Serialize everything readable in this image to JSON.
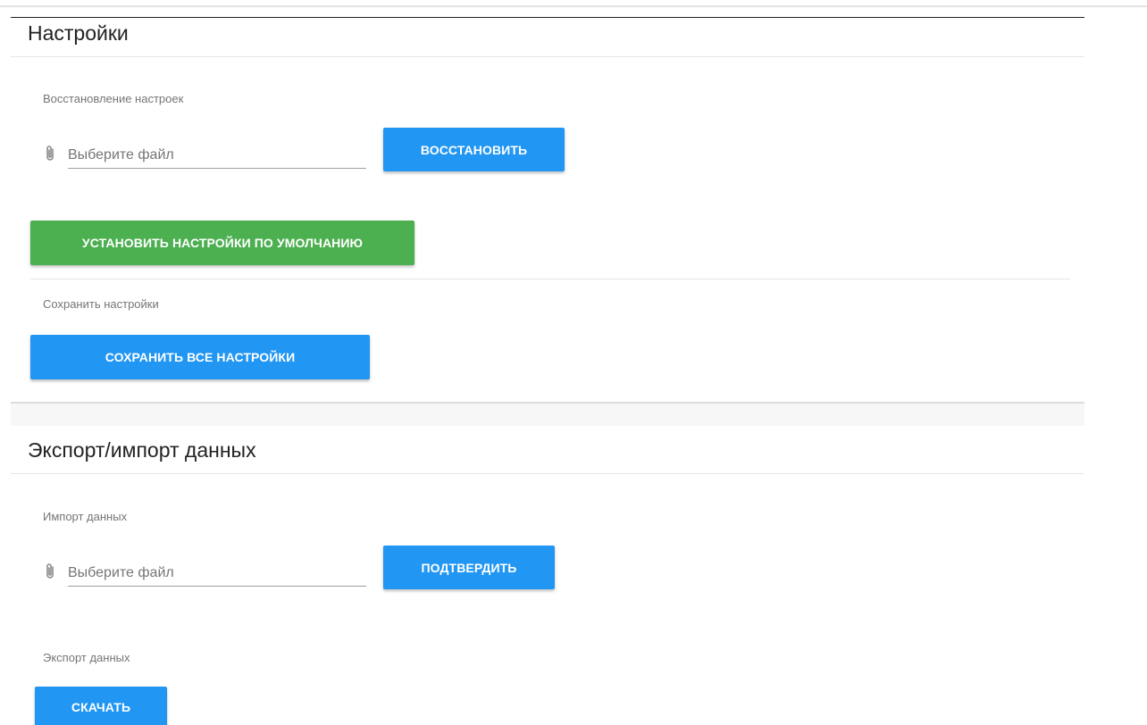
{
  "settings": {
    "title": "Настройки",
    "restore": {
      "label": "Восстановление настроек",
      "file_placeholder": "Выберите файл",
      "file_icon": "paperclip-icon",
      "button_label": "ВОССТАНОВИТЬ"
    },
    "defaults_button_label": "УСТАНОВИТЬ НАСТРОЙКИ ПО УМОЛЧАНИЮ",
    "save": {
      "label": "Сохранить настройки",
      "button_label": "СОХРАНИТЬ ВСЕ НАСТРОЙКИ"
    }
  },
  "data_exchange": {
    "title": "Экспорт/импорт данных",
    "import": {
      "label": "Импорт данных",
      "file_placeholder": "Выберите файл",
      "file_icon": "paperclip-icon",
      "button_label": "ПОДТВЕРДИТЬ"
    },
    "export": {
      "label": "Экспорт данных",
      "button_label": "СКАЧАТЬ"
    }
  },
  "colors": {
    "primary": "#2196f3",
    "success": "#4caf50"
  }
}
